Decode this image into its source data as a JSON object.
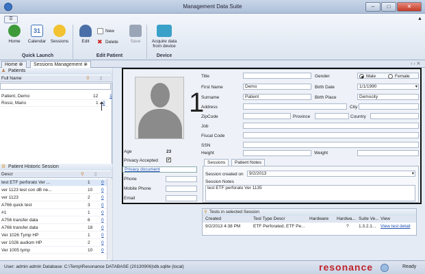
{
  "window": {
    "title": "Management Data Suite",
    "min": "–",
    "max": "□",
    "close": "✕"
  },
  "ribbon": {
    "quick_btn": "☰",
    "buttons": [
      {
        "label": "Home",
        "icon": "home-icon"
      },
      {
        "label": "Calendar",
        "icon": "calendar-icon"
      },
      {
        "label": "Sessions",
        "icon": "sessions-icon"
      },
      {
        "label": "Edit",
        "icon": "edit-icon"
      },
      {
        "label": "Save",
        "icon": "save-icon"
      },
      {
        "label": "Acquire data from device",
        "icon": "device-icon"
      }
    ],
    "small": {
      "new": "New",
      "delete": "Delete"
    },
    "groups": {
      "quick": "Quick Launch",
      "edit": "Edit Patient",
      "device": "Device"
    },
    "calendar_day": "31"
  },
  "tabs": [
    {
      "label": "Home"
    },
    {
      "label": "Sessions Management"
    }
  ],
  "patients": {
    "title": "Patients",
    "col_name": "Full Name",
    "rows": [
      {
        "name": "Patient, Demo",
        "a": "12",
        "b": "1"
      },
      {
        "name": "Rossi, Mario",
        "a": "1",
        "b": "0"
      }
    ]
  },
  "history": {
    "title": "Patient Historic Session",
    "col_descr": "Descr",
    "rows": [
      {
        "d": "test ETF perforato Ver ...",
        "a": "1",
        "b": "0"
      },
      {
        "d": "ver 1123 test con dB ne...",
        "a": "10",
        "b": "0"
      },
      {
        "d": "ver 1123",
        "a": "2",
        "b": "0"
      },
      {
        "d": "A766 quick test",
        "a": "3",
        "b": "0"
      },
      {
        "d": "#1",
        "a": "1",
        "b": "0"
      },
      {
        "d": "A756 transfer data",
        "a": "6",
        "b": "0"
      },
      {
        "d": "A766 transfer data",
        "a": "18",
        "b": "0"
      },
      {
        "d": "Ver 1026 Tymp HP",
        "a": "1",
        "b": "0"
      },
      {
        "d": "ver 1026 audiom HP",
        "a": "2",
        "b": "0"
      },
      {
        "d": "Ver 1005 tymp",
        "a": "10",
        "b": "0"
      }
    ]
  },
  "detail": {
    "photo_number": "1",
    "labels": {
      "title": "Title",
      "first": "First Name",
      "surname": "Surname",
      "address": "Address",
      "zip": "ZipCode",
      "province": "Province",
      "job": "Job",
      "fiscal": "Fiscal Code",
      "ssn": "SSN",
      "height": "Height",
      "weight": "Weight",
      "gender": "Gender",
      "male": "Male",
      "female": "Female",
      "birth_date": "Birth Date",
      "birth_place": "Birth Place",
      "city": "City",
      "country": "Country",
      "age": "Age",
      "privacy": "Privacy Accepted",
      "privacy_doc": "Privacy document",
      "phone": "Phone",
      "mobile": "Mobile Phone",
      "email": "Email"
    },
    "values": {
      "first": "Demo",
      "surname": "Patient",
      "birth_date": "1/1/1990",
      "birth_place": "Democity",
      "age": "23",
      "privacy_check": "✔"
    },
    "subtabs": {
      "sessions": "Sessions",
      "notes": "Patient Notes"
    },
    "session_created_label": "Session created on",
    "session_created_value": "9/2/2013",
    "session_notes_label": "Session Notes",
    "session_notes_value": "test ETF perforato Ver 1135"
  },
  "tests": {
    "title": "Tests in selected Session",
    "cols": [
      "Created",
      "Test Type Descr",
      "Hardware",
      "Hardwa...",
      "Suite Ve...",
      "View"
    ],
    "row": [
      "9/2/2013 4:38 PM",
      "ETF Perforated, ETF Pe...",
      "",
      "?",
      "1.3.2.1...",
      "View test detail"
    ]
  },
  "status": {
    "text": "User: admin admin  Database: C:\\Temp\\Resonance DATABASE (20130906)\\db.sqlite (local)",
    "brand": "resonance",
    "ready": "Ready"
  }
}
